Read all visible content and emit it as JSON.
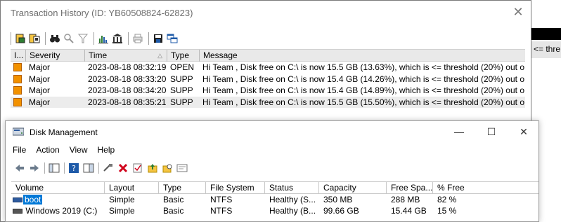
{
  "background_window": {
    "fragment_text": "<= thre"
  },
  "transaction_window": {
    "title": "Transaction History (ID: YB60508824-62823)",
    "close_glyph": "✕",
    "columns": [
      "I...",
      "Severity",
      "Time",
      "Type",
      "Message"
    ],
    "sort_indicator": "△",
    "rows": [
      {
        "severity": "Major",
        "time": "2023-08-18 08:32:19",
        "type": "OPEN",
        "message": "Hi Team , Disk free on C:\\ is now  15.5 GB (13.63%), which is <=  threshold (20%) out o"
      },
      {
        "severity": "Major",
        "time": "2023-08-18 08:33:20",
        "type": "SUPP",
        "message": "Hi Team , Disk free on C:\\ is now  15.4 GB (14.26%), which is <=  threshold (20%) out o"
      },
      {
        "severity": "Major",
        "time": "2023-08-18 08:34:20",
        "type": "SUPP",
        "message": "Hi Team , Disk free on C:\\ is now  15.4 GB (14.89%), which is <=  threshold (20%) out o"
      },
      {
        "severity": "Major",
        "time": "2023-08-18 08:35:21",
        "type": "SUPP",
        "message": "Hi Team , Disk free on C:\\ is now  15.5 GB (15.50%), which is <=  threshold (20%) out o"
      }
    ],
    "severity_color": "#f29100"
  },
  "disk_window": {
    "title": "Disk Management",
    "controls": {
      "minimize": "—",
      "maximize": "☐",
      "close": "✕"
    },
    "menu": [
      "File",
      "Action",
      "View",
      "Help"
    ],
    "columns": [
      "Volume",
      "Layout",
      "Type",
      "File System",
      "Status",
      "Capacity",
      "Free Spa...",
      "% Free"
    ],
    "rows": [
      {
        "volume": "boot",
        "layout": "Simple",
        "type": "Basic",
        "fs": "NTFS",
        "status": "Healthy (S...",
        "capacity": "350 MB",
        "free": "288 MB",
        "pct": "82 %"
      },
      {
        "volume": "Windows 2019 (C:)",
        "layout": "Simple",
        "type": "Basic",
        "fs": "NTFS",
        "status": "Healthy (B...",
        "capacity": "99.66 GB",
        "free": "15.44 GB",
        "pct": "15 %"
      }
    ],
    "selection_color": "#0078d7"
  }
}
